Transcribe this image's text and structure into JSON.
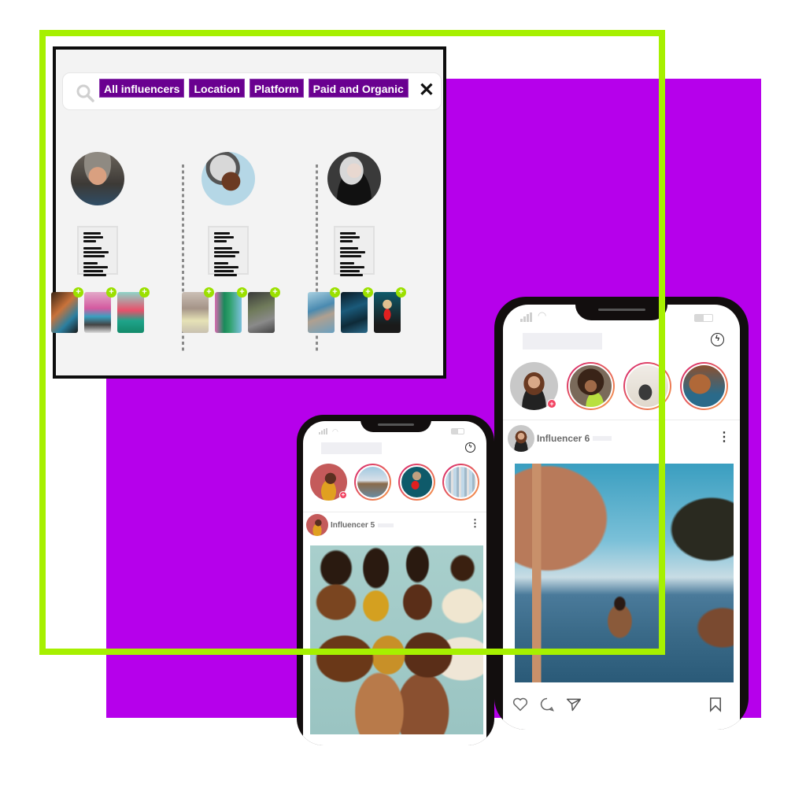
{
  "colors": {
    "brand_purple": "#b600eb",
    "chip_purple": "#6a0090",
    "accent_green": "#a6f000",
    "plus_green": "#9be000",
    "story_ring_start": "#d6246e",
    "story_ring_end": "#f59a4a"
  },
  "filter_panel": {
    "search_icon": "search-icon",
    "chips": [
      "All influencers",
      "Location",
      "Platform",
      "Paid and Organic"
    ],
    "close_label": "✕",
    "influencers": [
      {
        "avatar": "influencer-1-photo",
        "thumbnails": 3,
        "add_label": "+"
      },
      {
        "avatar": "influencer-2-photo",
        "thumbnails": 3,
        "add_label": "+"
      },
      {
        "avatar": "influencer-3-photo",
        "thumbnails": 3,
        "add_label": "+"
      }
    ]
  },
  "phone_small": {
    "messenger_icon": "messenger-icon",
    "stories": 4,
    "add_story_label": "+",
    "post": {
      "username": "Influencer 5",
      "menu_label": "⋮",
      "photo": "group-photo"
    }
  },
  "phone_large": {
    "messenger_icon": "messenger-icon",
    "stories": 4,
    "add_story_label": "+",
    "post": {
      "username": "Influencer 6",
      "menu_label": "⋮",
      "photo": "infinity-pool-photo"
    },
    "actions": [
      "heart-icon",
      "comment-icon",
      "share-icon",
      "bookmark-icon"
    ]
  }
}
